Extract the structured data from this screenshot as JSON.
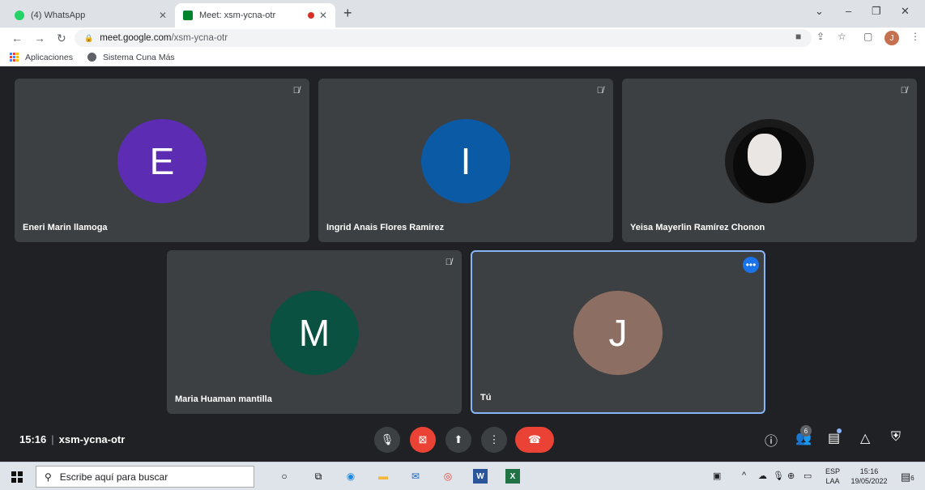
{
  "browser": {
    "tabs": [
      {
        "title": "(4) WhatsApp",
        "favicon_color": "#25d366"
      },
      {
        "title": "Meet: xsm-ycna-otr",
        "favicon_color": "#00832d"
      }
    ],
    "url_host": "meet.google.com",
    "url_path": "/xsm-ycna-otr",
    "profile_initial": "J",
    "bookmarks": [
      "Aplicaciones",
      "Sistema Cuna Más"
    ]
  },
  "meeting": {
    "time": "15:16",
    "code": "xsm-ycna-otr",
    "participant_count": "6",
    "participants": [
      {
        "name": "Eneri Marin llamoga",
        "initial": "E",
        "color": "#5c2db3"
      },
      {
        "name": "Ingrid Anais Flores Ramirez",
        "initial": "I",
        "color": "#0b5aa6"
      },
      {
        "name": "Yeisa Mayerlin Ramírez Chonon",
        "initial": "",
        "color": "#1a1a1a"
      },
      {
        "name": "Maria Huaman mantilla",
        "initial": "M",
        "color": "#0b5142"
      },
      {
        "name": "Tú",
        "initial": "J",
        "color": "#8d6e63"
      }
    ]
  },
  "taskbar": {
    "search_placeholder": "Escribe aquí para buscar",
    "lang_top": "ESP",
    "lang_bottom": "LAA",
    "time": "15:16",
    "date": "19/05/2022",
    "notif_count": "6"
  }
}
